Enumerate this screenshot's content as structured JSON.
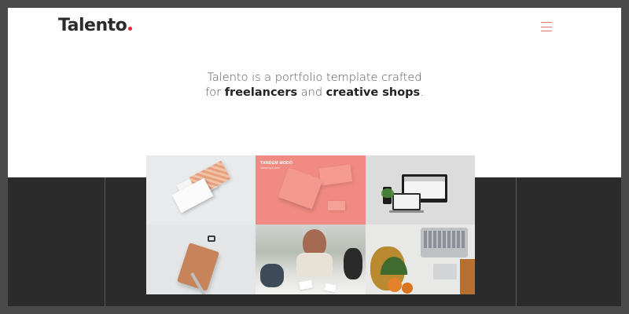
{
  "header": {
    "logo_text": "Talento",
    "logo_dot_color": "#e5282e",
    "menu_icon": "hamburger-icon",
    "menu_icon_color": "#e0745f"
  },
  "hero": {
    "line1": "Talento is a portfolio template crafted",
    "line2_prefix": "for ",
    "line2_bold1": "freelancers",
    "line2_middle": " and ",
    "line2_bold2": "creative shops",
    "line2_suffix": "."
  },
  "portfolio": {
    "tile2_title": "TANDEM MODO",
    "tile2_subtitle": "branding & print"
  },
  "colors": {
    "page_background": "#4a4a4a",
    "dark_section": "#2b2b2b",
    "hero_background": "#ffffff",
    "accent_pink": "#f08a82"
  }
}
